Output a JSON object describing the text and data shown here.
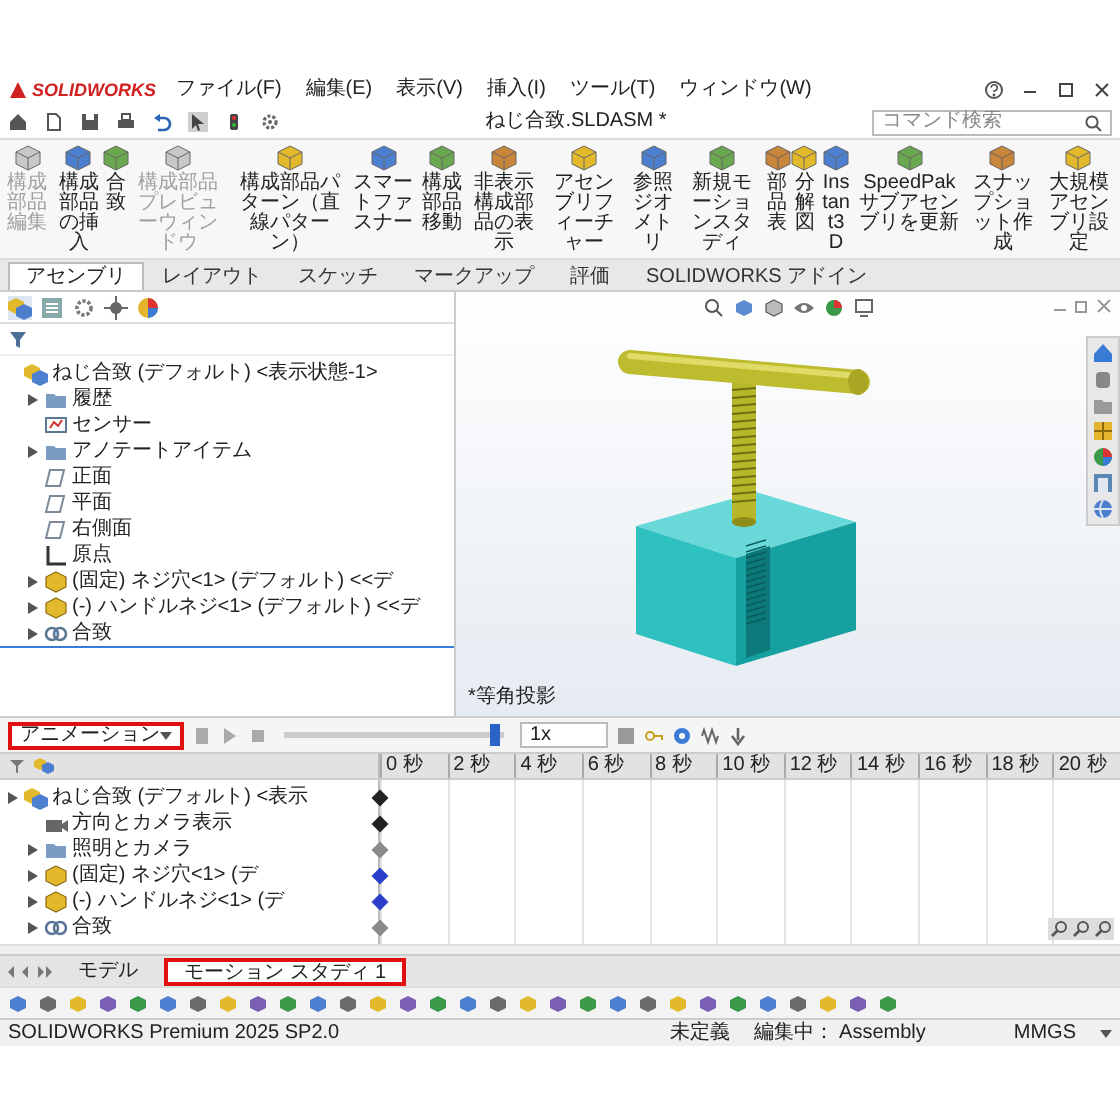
{
  "app": {
    "logo": "SOLIDWORKS",
    "menus": [
      "ファイル(F)",
      "編集(E)",
      "表示(V)",
      "挿入(I)",
      "ツール(T)",
      "ウィンドウ(W)"
    ],
    "title": "ねじ合致.SLDASM *",
    "search": {
      "placeholder": "コマンド検索"
    }
  },
  "ribbon": [
    {
      "label": "構成部品編集",
      "disabled": true
    },
    {
      "label": "構成部品の挿入",
      "disabled": false
    },
    {
      "label": "合致",
      "disabled": false
    },
    {
      "label": "構成部品プレビューウィンドウ",
      "disabled": true
    },
    {
      "label": "構成部品パターン（直線パターン）",
      "disabled": false
    },
    {
      "label": "スマートファスナー",
      "disabled": false
    },
    {
      "label": "構成部品移動",
      "disabled": false
    },
    {
      "label": "非表示構成部品の表示",
      "disabled": false
    },
    {
      "label": "アセンブリフィーチャー",
      "disabled": false
    },
    {
      "label": "参照ジオメトリ",
      "disabled": false
    },
    {
      "label": "新規モーションスタディ",
      "disabled": false
    },
    {
      "label": "部品表",
      "disabled": false
    },
    {
      "label": "分解図",
      "disabled": false
    },
    {
      "label": "Instant3D",
      "disabled": false
    },
    {
      "label": "SpeedPak サブアセンブリを更新",
      "disabled": false
    },
    {
      "label": "スナップショット作成",
      "disabled": false
    },
    {
      "label": "大規模アセンブリ設定",
      "disabled": false
    }
  ],
  "tabs": [
    {
      "label": "アセンブリ",
      "selected": true
    },
    {
      "label": "レイアウト",
      "selected": false
    },
    {
      "label": "スケッチ",
      "selected": false
    },
    {
      "label": "マークアップ",
      "selected": false
    },
    {
      "label": "評価",
      "selected": false
    },
    {
      "label": "SOLIDWORKS アドイン",
      "selected": false
    }
  ],
  "tree": {
    "label": "ねじ合致 (デフォルト) <表示状態-1>",
    "kind": "assembly",
    "expandable": false,
    "children": [
      {
        "label": "履歴",
        "kind": "folder",
        "expandable": true
      },
      {
        "label": "センサー",
        "kind": "sensor",
        "expandable": false
      },
      {
        "label": "アノテートアイテム",
        "kind": "folder",
        "expandable": true
      },
      {
        "label": "正面",
        "kind": "plane",
        "expandable": false
      },
      {
        "label": "平面",
        "kind": "plane",
        "expandable": false
      },
      {
        "label": "右側面",
        "kind": "plane",
        "expandable": false
      },
      {
        "label": "原点",
        "kind": "origin",
        "expandable": false
      },
      {
        "label": "(固定) ネジ穴<1> (デフォルト) <<デ",
        "kind": "part",
        "expandable": true
      },
      {
        "label": "(-) ハンドルネジ<1> (デフォルト) <<デ",
        "kind": "part",
        "expandable": true
      },
      {
        "label": "合致",
        "kind": "mates",
        "expandable": true
      }
    ]
  },
  "viewport": {
    "view_label": "*等角投影"
  },
  "motion": {
    "study_type": {
      "value": "アニメーション",
      "highlighted": true
    },
    "slider": {
      "level": 0.95
    },
    "speed": "1x",
    "time_labels": [
      "0 秒",
      "2 秒",
      "4 秒",
      "6 秒",
      "8 秒",
      "10 秒",
      "12 秒",
      "14 秒",
      "16 秒",
      "18 秒",
      "20 秒"
    ],
    "tree": {
      "label": "ねじ合致 (デフォルト) <表示",
      "kind": "assembly",
      "expandable": true,
      "color": "#222222",
      "children": [
        {
          "label": "方向とカメラ表示",
          "kind": "camera",
          "expandable": false,
          "color": "#222222"
        },
        {
          "label": "照明とカメラ",
          "kind": "folder",
          "expandable": true,
          "color": "#8a8a8a"
        },
        {
          "label": "(固定) ネジ穴<1> (デ",
          "kind": "part",
          "expandable": true,
          "color": "#2b3fc8"
        },
        {
          "label": "(-) ハンドルネジ<1> (デ",
          "kind": "part",
          "expandable": true,
          "color": "#2b3fc8"
        },
        {
          "label": "合致",
          "kind": "mates",
          "expandable": true,
          "color": "#8a8a8a"
        }
      ]
    }
  },
  "bottom_tabs": [
    {
      "label": "モデル",
      "selected": false,
      "highlighted": false
    },
    {
      "label": "モーション スタディ 1",
      "selected": true,
      "highlighted": true
    }
  ],
  "status_bar": {
    "product": "SOLIDWORKS Premium 2025 SP2.0",
    "state": "未定義",
    "mode": "編集中： Assembly",
    "units": "MMGS"
  }
}
